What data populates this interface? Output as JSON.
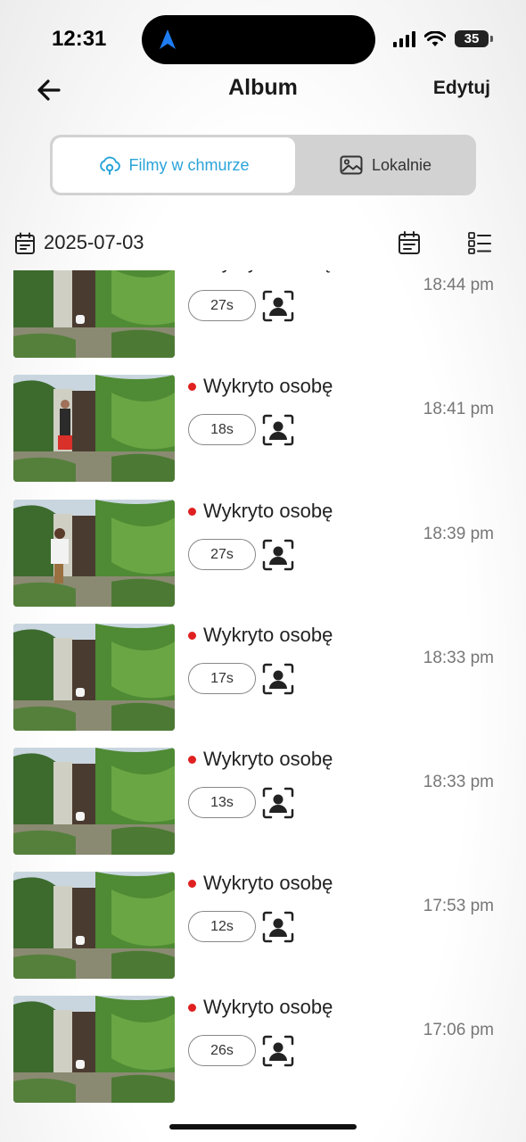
{
  "status_bar": {
    "time": "12:31",
    "battery": "35"
  },
  "header": {
    "title": "Album",
    "edit_label": "Edytuj"
  },
  "tabs": {
    "cloud_label": "Filmy w chmurze",
    "local_label": "Lokalnie"
  },
  "date": "2025-07-03",
  "colors": {
    "accent": "#2aa4d8",
    "event_dot": "#e02020"
  },
  "items": [
    {
      "event": "Wykryto osobę",
      "duration": "27s",
      "time": "18:44 pm"
    },
    {
      "event": "Wykryto osobę",
      "duration": "18s",
      "time": "18:41 pm"
    },
    {
      "event": "Wykryto osobę",
      "duration": "27s",
      "time": "18:39 pm"
    },
    {
      "event": "Wykryto osobę",
      "duration": "17s",
      "time": "18:33 pm"
    },
    {
      "event": "Wykryto osobę",
      "duration": "13s",
      "time": "18:33 pm"
    },
    {
      "event": "Wykryto osobę",
      "duration": "12s",
      "time": "17:53 pm"
    },
    {
      "event": "Wykryto osobę",
      "duration": "26s",
      "time": "17:06 pm"
    }
  ]
}
